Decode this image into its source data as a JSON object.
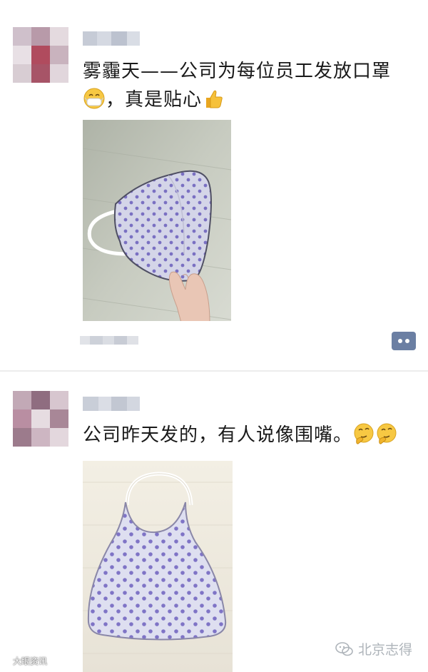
{
  "posts": [
    {
      "text_line1": "雾霾天——公司为每位员工发放口罩",
      "text_line2": "，真是贴心",
      "emoji_1": "mask-face-emoji",
      "emoji_2": "thumbs-up-emoji"
    },
    {
      "text_line1": "公司昨天发的，有人说像围嘴。",
      "emoji_1": "thinking-face-emoji",
      "emoji_2": "thinking-face-emoji"
    }
  ],
  "watermarks": {
    "left": "大眼资讯",
    "right": "北京志得"
  },
  "icons": {
    "comment": "comment-icon",
    "wechat_logo": "wechat-logo-icon"
  },
  "colors": {
    "comment_button": "#6b7fa3",
    "mask_fabric": "#d7d8ea",
    "mask_dots": "#7d73c4"
  }
}
